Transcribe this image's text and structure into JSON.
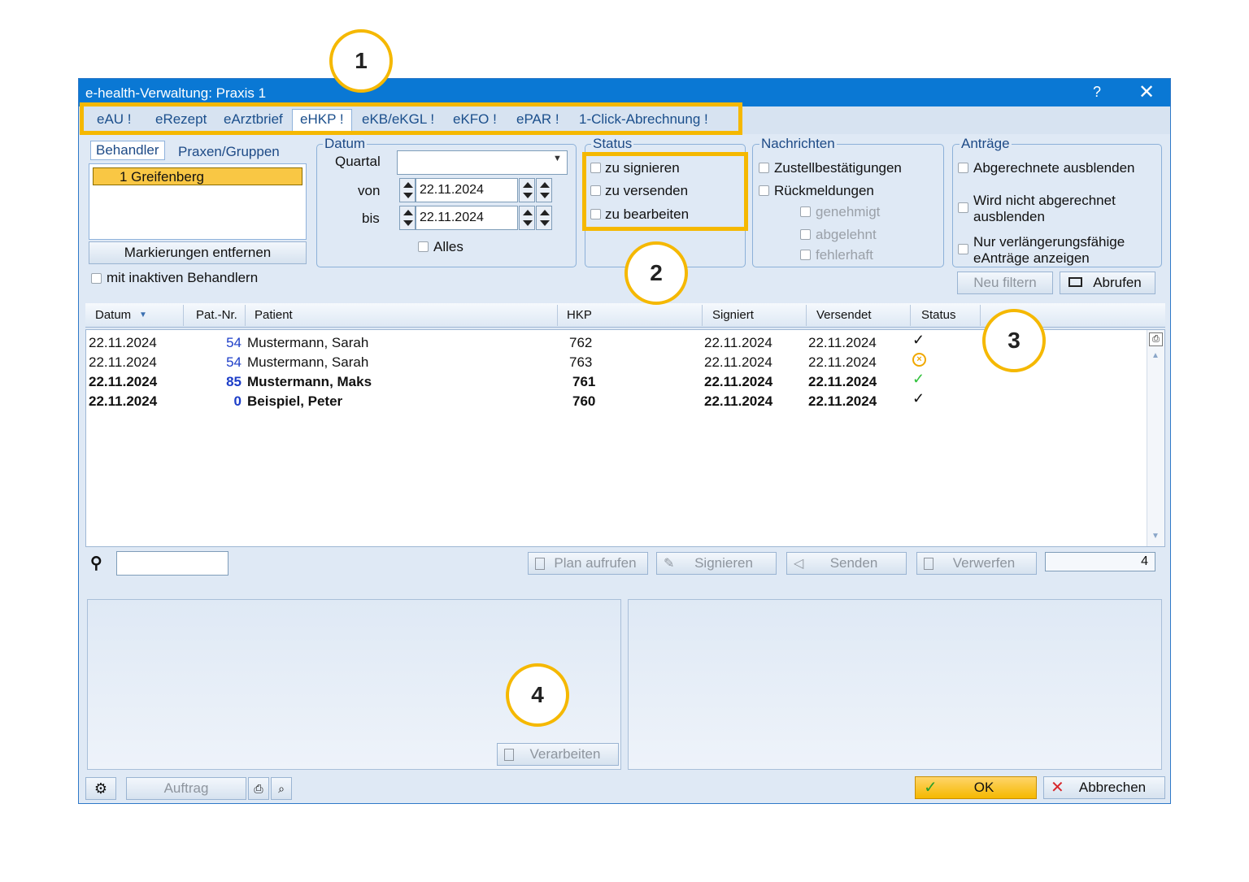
{
  "window": {
    "title": "e-health-Verwaltung: Praxis 1",
    "help": "?",
    "close": "✕"
  },
  "tabs": [
    "eAU !",
    "eRezept",
    "eArztbrief",
    "eHKP !",
    "eKB/eKGL !",
    "eKFO !",
    "ePAR !",
    "1-Click-Abrechnung !"
  ],
  "left": {
    "tab_behandler": "Behandler",
    "tab_praxen": "Praxen/Gruppen",
    "selected_item": "1 Greifenberg",
    "btn_markierungen": "Markierungen entfernen",
    "inactive_label": "mit inaktiven Behandlern"
  },
  "datum": {
    "group": "Datum",
    "quartal_label": "Quartal",
    "quartal_value": "",
    "von_label": "von",
    "von_value": "22.11.2024",
    "bis_label": "bis",
    "bis_value": "22.11.2024",
    "alles_label": "Alles"
  },
  "status": {
    "group": "Status",
    "opt1": "zu signieren",
    "opt2": "zu versenden",
    "opt3": "zu bearbeiten"
  },
  "nachrichten": {
    "group": "Nachrichten",
    "opt1": "Zustellbestätigungen",
    "opt2": "Rückmeldungen",
    "sub1": "genehmigt",
    "sub2": "abgelehnt",
    "sub3": "fehlerhaft"
  },
  "antraege": {
    "group": "Anträge",
    "opt1": "Abgerechnete ausblenden",
    "opt2_l1": "Wird nicht abgerechnet",
    "opt2_l2": "ausblenden",
    "opt3_l1": "Nur verlängerungsfähige",
    "opt3_l2": "eAnträge anzeigen",
    "btn_neu": "Neu filtern",
    "btn_abrufen": "Abrufen"
  },
  "table": {
    "headers": [
      "Datum",
      "Pat.-Nr.",
      "Patient",
      "HKP",
      "Signiert",
      "Versendet",
      "Status"
    ],
    "rows": [
      {
        "datum": "22.11.2024",
        "patnr": "54",
        "patient": "Mustermann, Sarah",
        "hkp": "762",
        "signiert": "22.11.2024",
        "versendet": "22.11.2024",
        "status": "check-icon"
      },
      {
        "datum": "22.11.2024",
        "patnr": "54",
        "patient": "Mustermann, Sarah",
        "hkp": "763",
        "signiert": "22.11.2024",
        "versendet": "22.11.2024",
        "status": "pending-icon"
      },
      {
        "datum": "22.11.2024",
        "patnr": "85",
        "patient": "Mustermann, Maks",
        "hkp": "761",
        "signiert": "22.11.2024",
        "versendet": "22.11.2024",
        "status": "green-check-icon"
      },
      {
        "datum": "22.11.2024",
        "patnr": "0",
        "patient": "Beispiel, Peter",
        "hkp": "760",
        "signiert": "22.11.2024",
        "versendet": "22.11.2024",
        "status": "check-icon"
      }
    ]
  },
  "actions": {
    "search_value": "",
    "plan": "Plan aufrufen",
    "signieren": "Signieren",
    "senden": "Senden",
    "verwerfen": "Verwerfen",
    "count": "4",
    "verarbeiten": "Verarbeiten"
  },
  "footer": {
    "auftrag": "Auftrag",
    "ok": "OK",
    "abbrechen": "Abbrechen"
  },
  "callouts": [
    "1",
    "2",
    "3",
    "4"
  ],
  "colors": {
    "titlebar": "#0a78d4",
    "highlight": "#f5b800",
    "selected_row": "#f9c744",
    "patnr": "#1d3ec8"
  }
}
